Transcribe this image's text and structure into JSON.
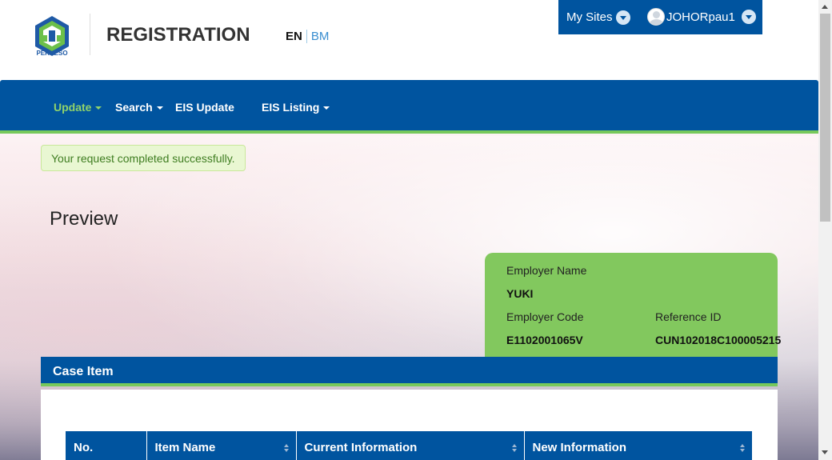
{
  "header": {
    "logo_text": "PERKESO",
    "title": "REGISTRATION",
    "lang_en": "EN",
    "lang_bm": "BM"
  },
  "topbar": {
    "my_sites": "My Sites",
    "username": "JOHORpau1"
  },
  "nav": {
    "items": [
      {
        "label": "Update",
        "dropdown": true,
        "active": true
      },
      {
        "label": "Search",
        "dropdown": true,
        "active": false
      },
      {
        "label": "EIS Update",
        "dropdown": false,
        "active": false
      },
      {
        "label": "EIS Listing",
        "dropdown": true,
        "active": false
      }
    ]
  },
  "alert": {
    "message": "Your request completed successfully."
  },
  "page_title": "Preview",
  "employer": {
    "name_label": "Employer Name",
    "name_value": "YUKI",
    "code_label": "Employer Code",
    "code_value": "E1102001065V",
    "ref_label": "Reference ID",
    "ref_value": "CUN102018C100005215"
  },
  "case_item": {
    "title": "Case Item",
    "columns": [
      "No.",
      "Item Name",
      "Current Information",
      "New Information"
    ]
  },
  "colors": {
    "primary": "#00549f",
    "accent": "#77c95b",
    "card": "#82c85e"
  }
}
